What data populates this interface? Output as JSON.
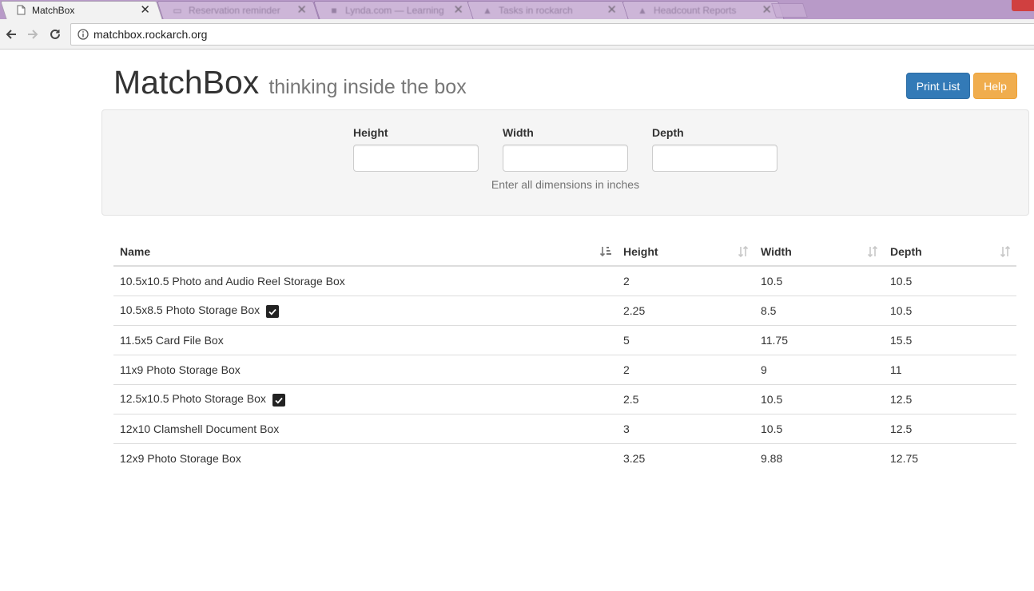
{
  "browser": {
    "tabs": [
      {
        "title": "MatchBox",
        "active": true
      },
      {
        "title": "Reservation reminder",
        "active": false
      },
      {
        "title": "Lynda.com — Learning",
        "active": false
      },
      {
        "title": "Tasks in rockarch",
        "active": false
      },
      {
        "title": "Headcount Reports",
        "active": false
      }
    ],
    "url": "matchbox.rockarch.org"
  },
  "header": {
    "title": "MatchBox",
    "subtitle": "thinking inside the box",
    "print_label": "Print List",
    "help_label": "Help"
  },
  "search": {
    "height_label": "Height",
    "width_label": "Width",
    "depth_label": "Depth",
    "height_value": "",
    "width_value": "",
    "depth_value": "",
    "hint": "Enter all dimensions in inches"
  },
  "table": {
    "columns": [
      "Name",
      "Height",
      "Width",
      "Depth"
    ],
    "rows": [
      {
        "name": "10.5x10.5 Photo and Audio Reel Storage Box",
        "height": "2",
        "width": "10.5",
        "depth": "10.5",
        "checked": false
      },
      {
        "name": "10.5x8.5 Photo Storage Box",
        "height": "2.25",
        "width": "8.5",
        "depth": "10.5",
        "checked": true
      },
      {
        "name": "11.5x5 Card File Box",
        "height": "5",
        "width": "11.75",
        "depth": "15.5",
        "checked": false
      },
      {
        "name": "11x9 Photo Storage Box",
        "height": "2",
        "width": "9",
        "depth": "11",
        "checked": false
      },
      {
        "name": "12.5x10.5 Photo Storage Box",
        "height": "2.5",
        "width": "10.5",
        "depth": "12.5",
        "checked": true
      },
      {
        "name": "12x10 Clamshell Document Box",
        "height": "3",
        "width": "10.5",
        "depth": "12.5",
        "checked": false
      },
      {
        "name": "12x9 Photo Storage Box",
        "height": "3.25",
        "width": "9.88",
        "depth": "12.75",
        "checked": false
      }
    ]
  },
  "colors": {
    "primary": "#337ab7",
    "warning": "#f0ad4e"
  }
}
